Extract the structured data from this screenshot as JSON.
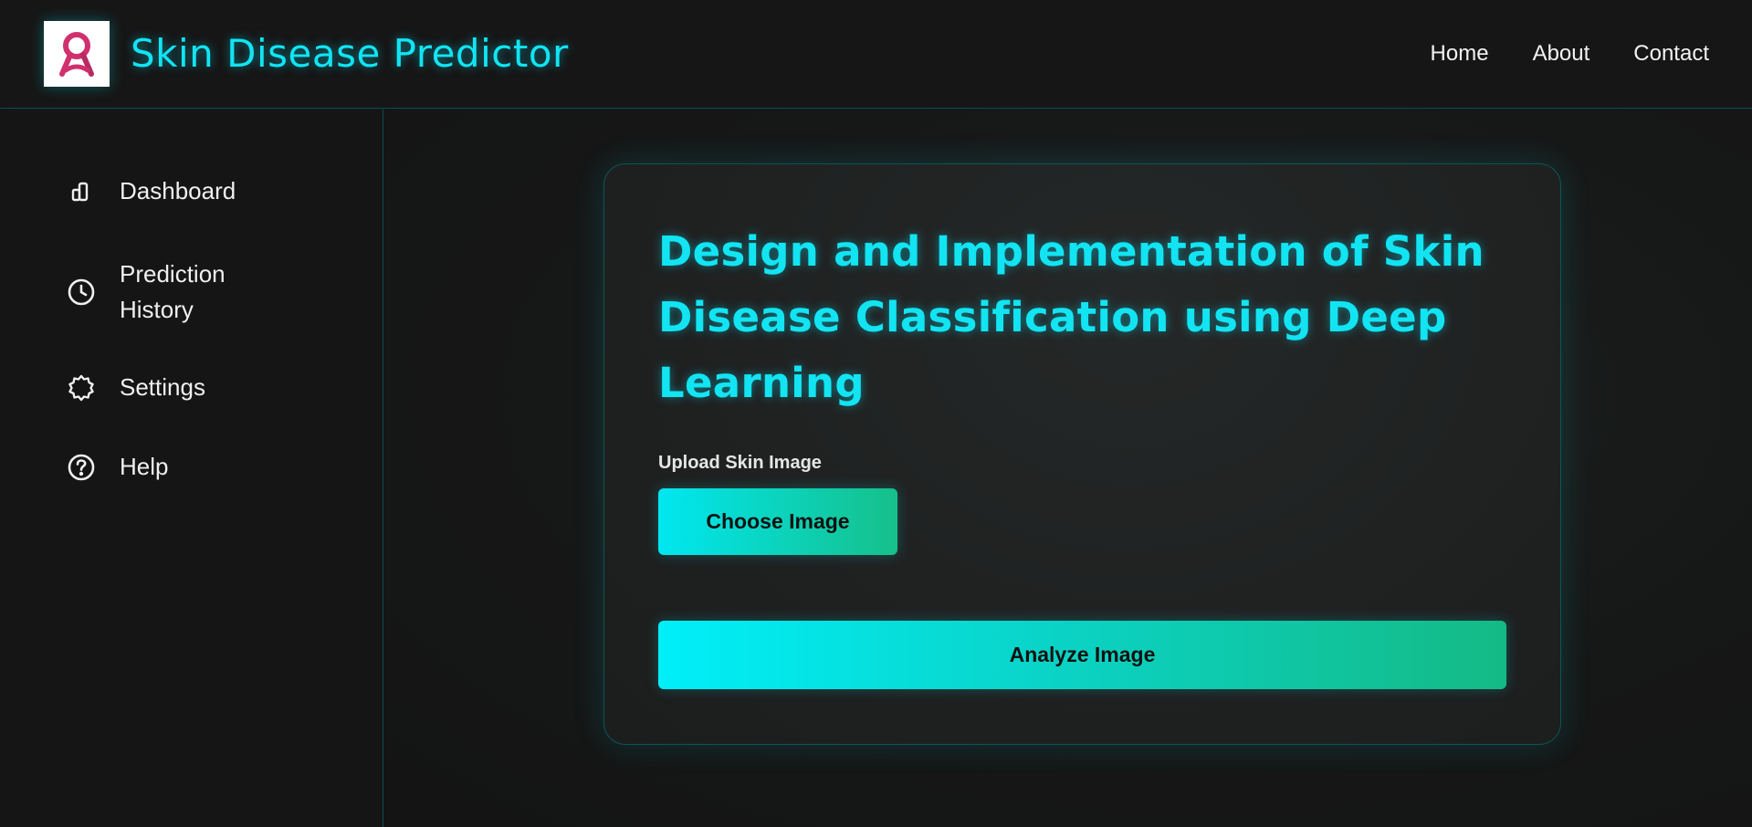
{
  "header": {
    "logo_icon": "ribbon-logo-icon",
    "title": "Skin Disease Predictor",
    "nav": [
      "Home",
      "About",
      "Contact"
    ]
  },
  "sidebar": {
    "items": [
      {
        "label": "Dashboard",
        "icon": "dashboard-icon"
      },
      {
        "label": "Prediction History",
        "icon": "clock-icon"
      },
      {
        "label": "Settings",
        "icon": "gear-icon"
      },
      {
        "label": "Help",
        "icon": "help-icon"
      }
    ]
  },
  "main": {
    "title": "Design and Implementation of Skin Disease Classification using Deep Learning",
    "upload_label": "Upload Skin Image",
    "choose_button": "Choose Image",
    "analyze_button": "Analyze Image"
  },
  "colors": {
    "accent": "#12e4f2",
    "gradient_start": "#00eff9",
    "gradient_end": "#14ba84",
    "background": "#151515",
    "logo_ribbon": "#d0306e"
  }
}
